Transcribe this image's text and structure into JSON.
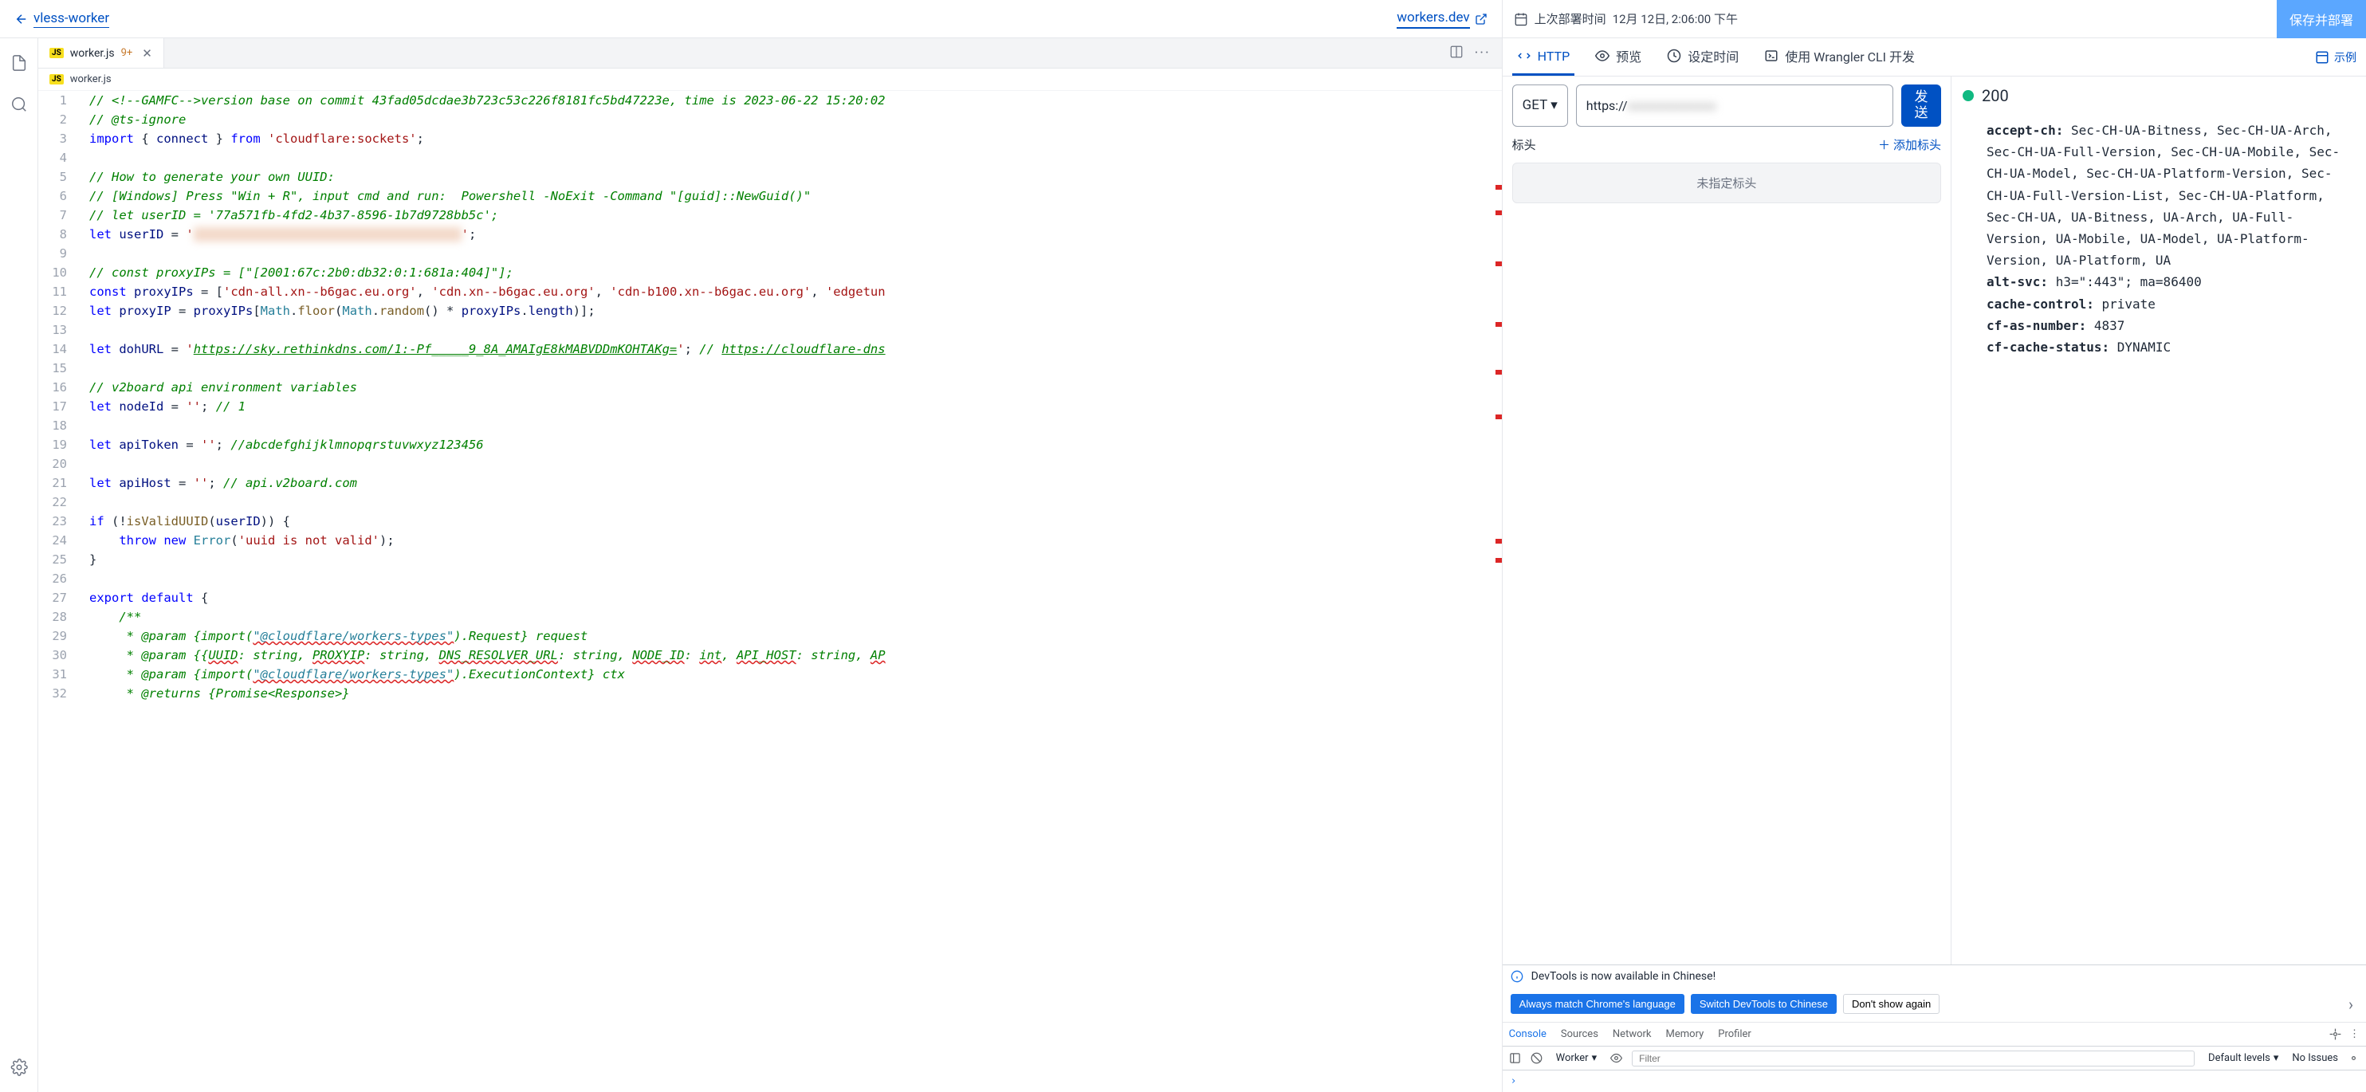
{
  "header": {
    "back_label": "vless-worker",
    "workers_link": "workers.dev",
    "deploy_prefix": "上次部署时间",
    "deploy_time": "12月 12日, 2:06:00 下午",
    "deploy_button": "保存并部署"
  },
  "editor": {
    "tab": {
      "filename": "worker.js",
      "diff": "9+"
    },
    "breadcrumb": "worker.js",
    "lines": [
      {
        "n": 1,
        "html": "<span class='cm-comment'>// &lt;!--GAMFC--&gt;version base on commit 43fad05dcdae3b723c53c226f8181fc5bd47223e, time is 2023-06-22 15:20:02</span>"
      },
      {
        "n": 2,
        "html": "<span class='cm-comment'>// @ts-ignore</span>"
      },
      {
        "n": 3,
        "html": "<span class='cm-kw'>import</span> { <span class='cm-prop'>connect</span> } <span class='cm-kw'>from</span> <span class='cm-str'>'cloudflare:sockets'</span>;"
      },
      {
        "n": 4,
        "html": ""
      },
      {
        "n": 5,
        "html": "<span class='cm-comment'>// How to generate your own UUID:</span>"
      },
      {
        "n": 6,
        "html": "<span class='cm-comment'>// [Windows] Press \"Win + R\", input cmd and run:  Powershell -NoExit -Command \"[guid]::NewGuid()\"</span>"
      },
      {
        "n": 7,
        "html": "<span class='cm-comment'>// let userID = '77a571fb-4fd2-4b37-8596-1b7d9728bb5c';</span>"
      },
      {
        "n": 8,
        "html": "<span class='cm-kw'>let</span> <span class='cm-prop'>userID</span> = <span class='cm-str'>'<span class='cm-blur'>xxxxxxxxxxxxxxxxxxxxxxxxxxxxxxxxxxxx</span>'</span>;"
      },
      {
        "n": 9,
        "html": ""
      },
      {
        "n": 10,
        "html": "<span class='cm-comment'>// const proxyIPs = [\"[2001:67c:2b0:db32:0:1:681a:404]\"];</span>"
      },
      {
        "n": 11,
        "html": "<span class='cm-kw'>const</span> <span class='cm-prop'>proxyIPs</span> = [<span class='cm-str'>'cdn-all.xn--b6gac.eu.org'</span>, <span class='cm-str'>'cdn.xn--b6gac.eu.org'</span>, <span class='cm-str'>'cdn-b100.xn--b6gac.eu.org'</span>, <span class='cm-str'>'edgetun</span>"
      },
      {
        "n": 12,
        "html": "<span class='cm-kw'>let</span> <span class='cm-prop'>proxyIP</span> = <span class='cm-prop'>proxyIPs</span>[<span class='cm-type'>Math</span>.<span class='cm-fn'>floor</span>(<span class='cm-type'>Math</span>.<span class='cm-fn'>random</span>() * <span class='cm-prop'>proxyIPs</span>.<span class='cm-prop'>length</span>)];"
      },
      {
        "n": 13,
        "html": ""
      },
      {
        "n": 14,
        "html": "<span class='cm-kw'>let</span> <span class='cm-prop'>dohURL</span> = <span class='cm-str'>'<span class='cm-url'>https://sky.rethinkdns.com/1:-Pf_____9_8A_AMAIgE8kMABVDDmKOHTAKg=</span>'</span>; <span class='cm-comment'>// <span class='cm-url'>https://cloudflare-dns</span></span>"
      },
      {
        "n": 15,
        "html": ""
      },
      {
        "n": 16,
        "html": "<span class='cm-comment'>// v2board api environment variables</span>"
      },
      {
        "n": 17,
        "html": "<span class='cm-kw'>let</span> <span class='cm-prop'>nodeId</span> = <span class='cm-str'>''</span>; <span class='cm-comment'>// 1</span>"
      },
      {
        "n": 18,
        "html": ""
      },
      {
        "n": 19,
        "html": "<span class='cm-kw'>let</span> <span class='cm-prop'>apiToken</span> = <span class='cm-str'>''</span>; <span class='cm-comment'>//abcdefghijklmnopqrstuvwxyz123456</span>"
      },
      {
        "n": 20,
        "html": ""
      },
      {
        "n": 21,
        "html": "<span class='cm-kw'>let</span> <span class='cm-prop'>apiHost</span> = <span class='cm-str'>''</span>; <span class='cm-comment'>// api.v2board.com</span>"
      },
      {
        "n": 22,
        "html": ""
      },
      {
        "n": 23,
        "html": "<span class='cm-kw'>if</span> (!<span class='cm-fn'>isValidUUID</span>(<span class='cm-prop'>userID</span>)) {"
      },
      {
        "n": 24,
        "html": "    <span class='cm-kw'>throw new</span> <span class='cm-type'>Error</span>(<span class='cm-str'>'uuid is not valid'</span>);"
      },
      {
        "n": 25,
        "html": "}"
      },
      {
        "n": 26,
        "html": ""
      },
      {
        "n": 27,
        "html": "<span class='cm-kw'>export default</span> {"
      },
      {
        "n": 28,
        "html": "    <span class='cm-comment'>/**</span>"
      },
      {
        "n": 29,
        "html": "    <span class='cm-comment'> * @param {import(<span class='cm-jstype'>\"@cloudflare/workers-types\"</span>).Request} request</span>"
      },
      {
        "n": 30,
        "html": "    <span class='cm-comment'> * @param {{<span class='cm-red'>UUID</span>: string, <span class='cm-red'>PROXYIP</span>: string, <span class='cm-red'>DNS_RESOLVER_URL</span>: string, <span class='cm-red'>NODE_ID</span>: <span class='cm-red'>int</span>, <span class='cm-red'>API_HOST</span>: string, <span class='cm-red'>AP</span></span>"
      },
      {
        "n": 31,
        "html": "    <span class='cm-comment'> * @param {import(<span class='cm-jstype'>\"@cloudflare/workers-types\"</span>).ExecutionContext} ctx</span>"
      },
      {
        "n": 32,
        "html": "    <span class='cm-comment'> * @returns {Promise&lt;Response&gt;}</span>"
      }
    ]
  },
  "request_tabs": {
    "http": "HTTP",
    "preview": "预览",
    "schedule": "设定时间",
    "wrangler": "使用 Wrangler CLI 开发",
    "example": "示例"
  },
  "request": {
    "method": "GET",
    "url_prefix": "https://",
    "send": "发送",
    "headers_label": "标头",
    "add_header": "添加标头",
    "no_headers": "未指定标头"
  },
  "response": {
    "status": "200",
    "headers": [
      {
        "k": "accept-ch",
        "v": "Sec-CH-UA-Bitness, Sec-CH-UA-Arch, Sec-CH-UA-Full-Version, Sec-CH-UA-Mobile, Sec-CH-UA-Model, Sec-CH-UA-Platform-Version, Sec-CH-UA-Full-Version-List, Sec-CH-UA-Platform, Sec-CH-UA, UA-Bitness, UA-Arch, UA-Full-Version, UA-Mobile, UA-Model, UA-Platform-Version, UA-Platform, UA"
      },
      {
        "k": "alt-svc",
        "v": "h3=\":443\"; ma=86400"
      },
      {
        "k": "cache-control",
        "v": "private"
      },
      {
        "k": "cf-as-number",
        "v": "4837"
      },
      {
        "k": "cf-cache-status",
        "v": "DYNAMIC"
      }
    ]
  },
  "devtools": {
    "banner_text": "DevTools is now available in Chinese!",
    "btn_match": "Always match Chrome's language",
    "btn_switch": "Switch DevTools to Chinese",
    "btn_dont": "Don't show again",
    "tabs": [
      "Console",
      "Sources",
      "Network",
      "Memory",
      "Profiler"
    ],
    "context": "Worker",
    "filter_placeholder": "Filter",
    "levels": "Default levels",
    "no_issues": "No Issues"
  }
}
